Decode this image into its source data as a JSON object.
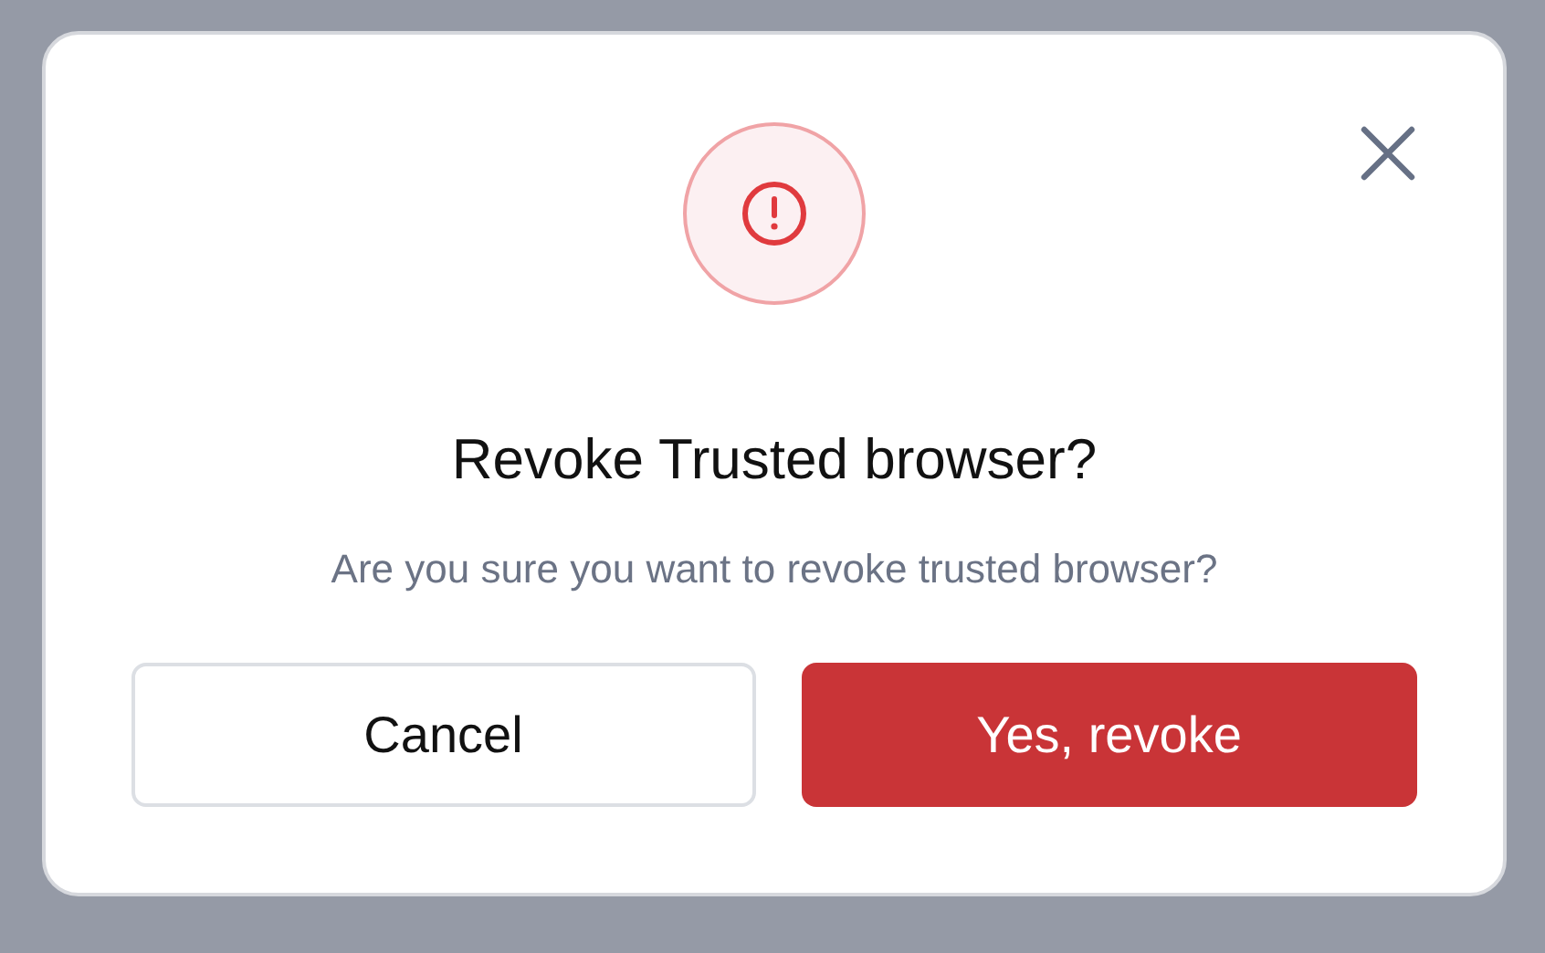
{
  "dialog": {
    "title": "Revoke Trusted browser?",
    "message": "Are you sure you want to revoke trusted browser?",
    "buttons": [
      {
        "label": "Cancel",
        "kind": "secondary"
      },
      {
        "label": "Yes, revoke",
        "kind": "danger"
      }
    ]
  }
}
